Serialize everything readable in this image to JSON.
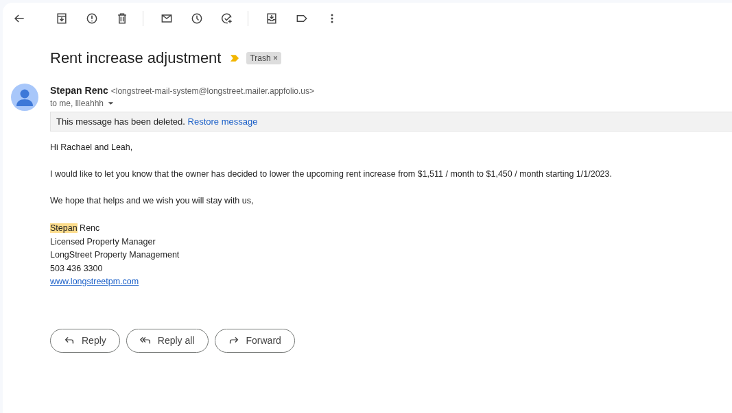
{
  "subject": "Rent increase adjustment",
  "important": true,
  "labels": [
    {
      "text": "Trash",
      "remove": "×"
    }
  ],
  "sender": {
    "name": "Stepan Renc",
    "email": "<longstreet-mail-system@longstreet.mailer.appfolio.us>",
    "recipients": "to me, llleahhh"
  },
  "notice": {
    "text": "This message has been deleted.",
    "link": "Restore message"
  },
  "body": [
    "Hi Rachael and Leah,",
    "I would like to let you know that the owner has decided to lower the upcoming rent increase from $1,511 / month to $1,450 / month starting 1/1/2023.",
    "We hope that helps and we wish you will stay with us,"
  ],
  "signature": {
    "highlighted": "Stepan",
    "name_rest": " Renc",
    "lines": [
      "Licensed Property Manager",
      "LongStreet Property Management",
      "503 436 3300"
    ],
    "link": "www.longstreetpm.com"
  },
  "actions": [
    {
      "kind": "reply",
      "label": "Reply"
    },
    {
      "kind": "reply_all",
      "label": "Reply all"
    },
    {
      "kind": "forward",
      "label": "Forward"
    }
  ]
}
